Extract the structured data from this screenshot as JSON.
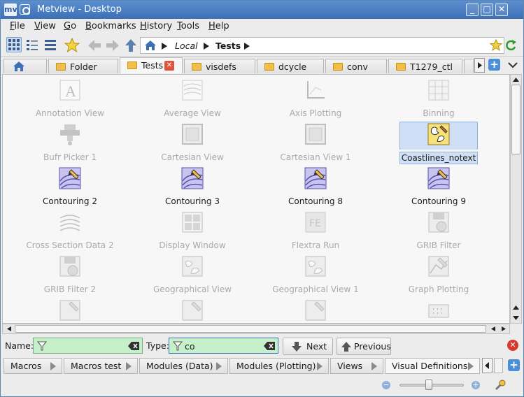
{
  "window": {
    "title": "Metview - Desktop"
  },
  "menu": {
    "items": [
      "File",
      "View",
      "Go",
      "Bookmarks",
      "History",
      "Tools",
      "Help"
    ]
  },
  "breadcrumb": {
    "parts": [
      "Local",
      "Tests"
    ]
  },
  "folder_tabs": [
    {
      "label": "Folder"
    },
    {
      "label": "Tests"
    },
    {
      "label": "visdefs"
    },
    {
      "label": "dcycle"
    },
    {
      "label": "conv"
    },
    {
      "label": "T1279_ctl"
    }
  ],
  "icons": [
    {
      "name": "Annotation View",
      "state": "dim"
    },
    {
      "name": "Average View",
      "state": "dim"
    },
    {
      "name": "Axis Plotting",
      "state": "dim"
    },
    {
      "name": "Binning",
      "state": "dim"
    },
    {
      "name": "Bufr Picker 1",
      "state": "dim"
    },
    {
      "name": "Cartesian View",
      "state": "dim"
    },
    {
      "name": "Cartesian View 1",
      "state": "dim"
    },
    {
      "name": "Coastlines_notext",
      "state": "selected"
    },
    {
      "name": "Contouring 2",
      "state": "normal"
    },
    {
      "name": "Contouring 3",
      "state": "normal"
    },
    {
      "name": "Contouring 8",
      "state": "normal"
    },
    {
      "name": "Contouring 9",
      "state": "normal"
    },
    {
      "name": "Cross Section Data 2",
      "state": "dim"
    },
    {
      "name": "Display Window",
      "state": "dim"
    },
    {
      "name": "Flextra Run",
      "state": "dim"
    },
    {
      "name": "GRIB Filter",
      "state": "dim"
    },
    {
      "name": "GRIB Filter 2",
      "state": "dim"
    },
    {
      "name": "Geographical View",
      "state": "dim"
    },
    {
      "name": "Geographical View 1",
      "state": "dim"
    },
    {
      "name": "Graph Plotting",
      "state": "dim"
    }
  ],
  "filter": {
    "name_label": "Name:",
    "name_value": "",
    "type_label": "Type:",
    "type_value": "co",
    "next_label": "Next",
    "previous_label": "Previous"
  },
  "bottom_tabs": [
    {
      "label": "Macros"
    },
    {
      "label": "Macros test"
    },
    {
      "label": "Modules (Data)"
    },
    {
      "label": "Modules (Plotting)"
    },
    {
      "label": "Views"
    },
    {
      "label": "Visual Definitions"
    }
  ],
  "zoom": {
    "level": 0.45
  }
}
